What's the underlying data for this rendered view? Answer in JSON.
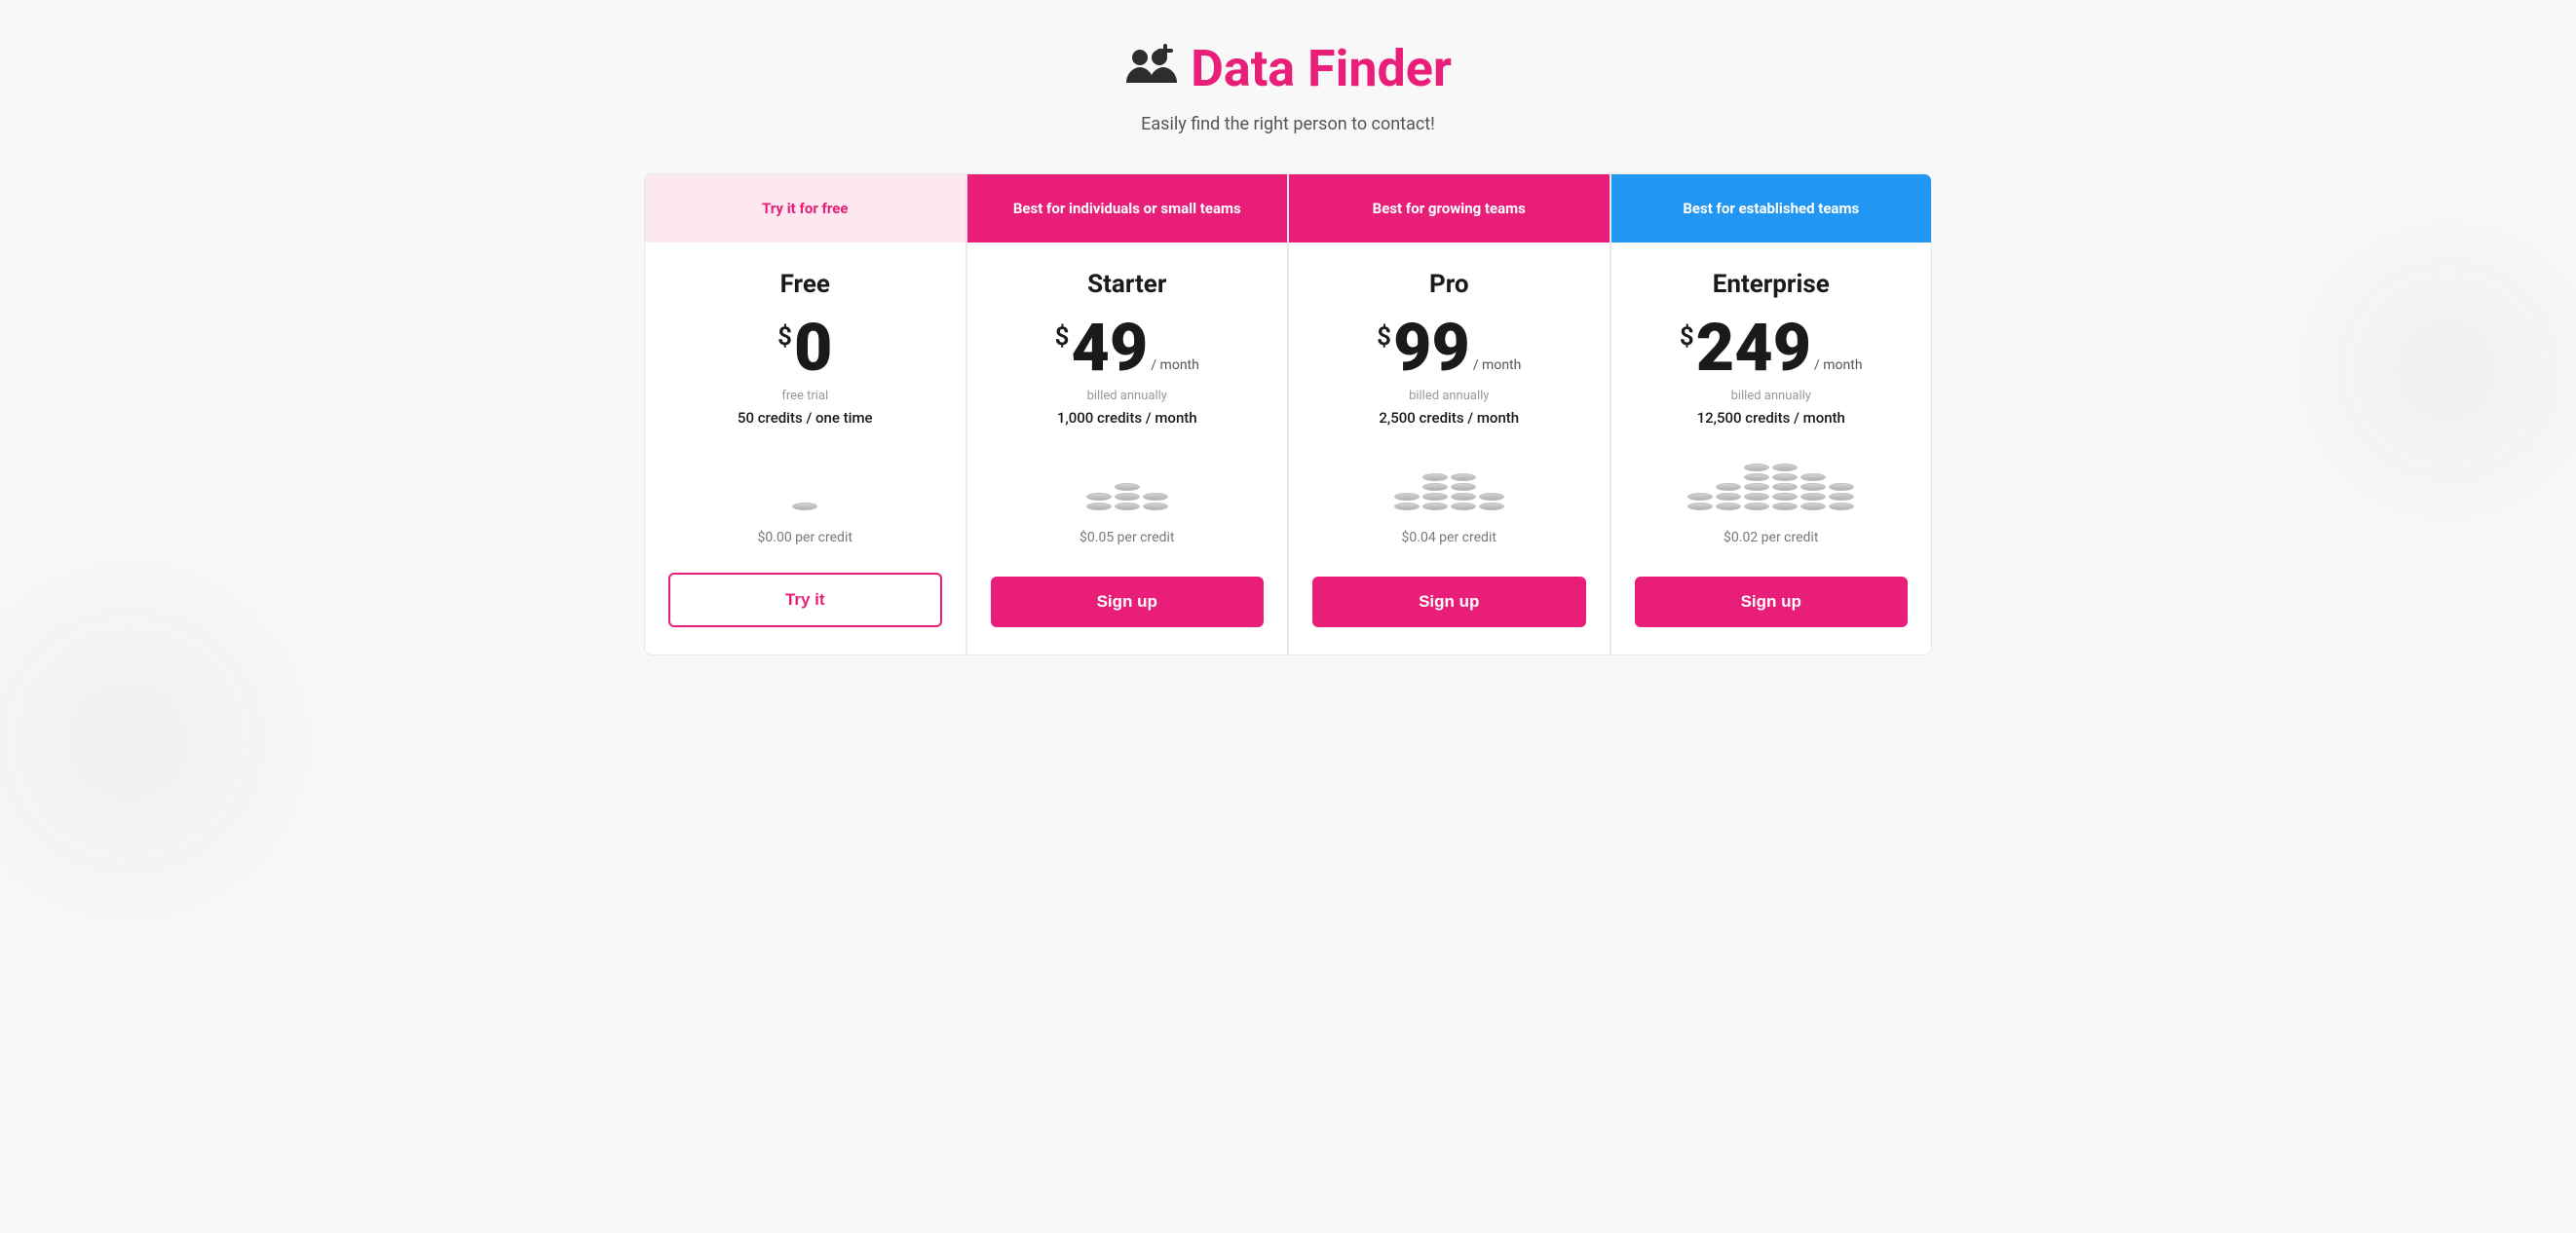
{
  "header": {
    "title": "Data Finder",
    "subtitle": "Easily find the right person to contact!"
  },
  "plans": [
    {
      "id": "free",
      "banner_text": "Try it for free",
      "banner_style": "free",
      "name": "Free",
      "price": "0",
      "price_period": "",
      "billing_note": "free trial",
      "credits_note": "50 credits / one time",
      "per_credit": "$0.00 per credit",
      "coin_size": "small",
      "cta_label": "Try it",
      "cta_style": "free"
    },
    {
      "id": "starter",
      "banner_text": "Best for individuals or small teams",
      "banner_style": "starter",
      "name": "Starter",
      "price": "49",
      "price_period": "/ month",
      "billing_note": "billed annually",
      "credits_note": "1,000 credits / month",
      "per_credit": "$0.05 per credit",
      "coin_size": "medium",
      "cta_label": "Sign up",
      "cta_style": "paid"
    },
    {
      "id": "pro",
      "banner_text": "Best for growing teams",
      "banner_style": "pro",
      "name": "Pro",
      "price": "99",
      "price_period": "/ month",
      "billing_note": "billed annually",
      "credits_note": "2,500 credits / month",
      "per_credit": "$0.04 per credit",
      "coin_size": "large",
      "cta_label": "Sign up",
      "cta_style": "paid"
    },
    {
      "id": "enterprise",
      "banner_text": "Best for established teams",
      "banner_style": "enterprise",
      "name": "Enterprise",
      "price": "249",
      "price_period": "/ month",
      "billing_note": "billed annually",
      "credits_note": "12,500 credits / month",
      "per_credit": "$0.02 per credit",
      "coin_size": "xlarge",
      "cta_label": "Sign up",
      "cta_style": "paid"
    }
  ]
}
